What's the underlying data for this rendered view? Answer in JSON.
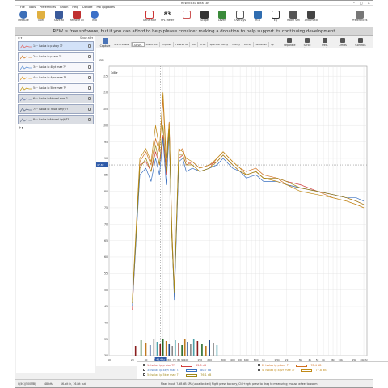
{
  "window": {
    "title": "REW V5.40 Beta 189"
  },
  "menu": [
    "File",
    "Tools",
    "Preferences",
    "Graph",
    "Help",
    "Donate",
    "Pro upgrades"
  ],
  "toolbar": {
    "left": [
      "Measure",
      "Open",
      "Save all",
      "Remove all",
      "Info"
    ],
    "right": [
      "Preferences"
    ],
    "center": [
      "Generator",
      "Scope",
      "Levels",
      "Overlays",
      "RTA",
      "EQ",
      "Room sim",
      "Arithmetic"
    ],
    "spl_meter": {
      "value": "83",
      "label": "SPL meter"
    }
  },
  "donate_text": "REW is free software, but if you can afford to help please consider making a donation to help support its continuing development",
  "left_panel": {
    "header_left": "⊗ ▾",
    "header_right": "Show all ▾",
    "footer": "⟳ ▾"
  },
  "measurements": [
    {
      "name": "1: ·· Isolax ip p stoly ??",
      "color": "#e07070",
      "state": "sel"
    },
    {
      "name": "2: ·· Isolax ip p tanr ??",
      "color": "#d08030",
      "state": "normal"
    },
    {
      "name": "3: ·· Isolax ip 4kyt mae ??",
      "color": "#6a9ad8",
      "state": "normal"
    },
    {
      "name": "4: ·· Isolax ip 4gvr mae ??",
      "color": "#e0a030",
      "state": "normal"
    },
    {
      "name": "5: ·· Isolax ip 5kre mae ??",
      "color": "#c8a020",
      "state": "normal"
    },
    {
      "name": "6: ·· Isolax ip4d seal mae ?",
      "color": "#7080a8",
      "state": "dim"
    },
    {
      "name": "7: ·· Isolax ip ?dual 4sr(r)??",
      "color": "#6a7890",
      "state": "dim"
    },
    {
      "name": "8: ·· Isolax ip4d seal 4p(t)??",
      "color": "#7a8498",
      "state": "dim"
    }
  ],
  "capture_label": "Capture",
  "graph_tabs": [
    "SPL & Phase",
    "All SPL",
    "Distortion",
    "Impulse",
    "Filtered IR",
    "GD",
    "RT60",
    "Spectral Decay",
    "Clarity",
    "Decay",
    "Waterfall",
    "Sp"
  ],
  "graph_tools": [
    "Separate",
    "Scroll bars",
    "Freq. Axis",
    "Limits",
    "Controls"
  ],
  "axis": {
    "ylabel": "SPL",
    "yunit_select": "?dB",
    "marker_left": "47.82",
    "xticks": [
      "10",
      "20",
      "30",
      "40",
      "50",
      "60",
      "70",
      "80",
      "90",
      "100",
      "150",
      "200",
      "300",
      "400",
      "500",
      "600",
      "800",
      "1k",
      "1.5k",
      "2k",
      "3k",
      "4k",
      "5k",
      "6k",
      "8k",
      "10k",
      "15k",
      "20kHz"
    ],
    "xcursor": "46.4Hz",
    "yticks": [
      "115",
      "110",
      "105",
      "100",
      "95",
      "90",
      "85",
      "80",
      "75",
      "70",
      "65",
      "60",
      "55",
      "50",
      "45",
      "40",
      "35",
      "30"
    ]
  },
  "legend": [
    {
      "name": "1: Isolax ip p stor ??",
      "value": "63.8 dB",
      "color": "#d04040"
    },
    {
      "name": "2: Isolax ip p tanr ??",
      "value": "78.4 dB",
      "color": "#d07020"
    },
    {
      "name": "3: Isolax ip 4kyt mae ??",
      "value": "80.7 dB",
      "color": "#3a70c0"
    },
    {
      "name": "4: Isolax ip 4gvr mae ??",
      "value": "77.8 dB",
      "color": "#c08a18"
    },
    {
      "name": "5: Isolax ip 5kre mae ??",
      "value": "76.1 dB",
      "color": "#a08818"
    }
  ],
  "status": {
    "left": "C(IIC)(500MB)",
    "rate": "48 kHz",
    "bits": "16-bit in, 16-bit out",
    "hint": "Mass input: ?-dB dB SPL (uncalibrated)  Right press to carry, Ctrl+right press to drag to measuring; mouse wheel to zoom"
  },
  "chart_data": {
    "type": "line",
    "xlabel": "",
    "ylabel": "SPL",
    "x_scale": "log",
    "xlim": [
      10,
      22000
    ],
    "ylim": [
      30,
      118
    ],
    "grid": true,
    "x": [
      20,
      25,
      30,
      35,
      40,
      45,
      50,
      55,
      60,
      65,
      70,
      80,
      90,
      100,
      120,
      150,
      200,
      250,
      300,
      400,
      500,
      600,
      800,
      1000,
      1500,
      2000,
      3000,
      5000,
      8000,
      12000,
      16000,
      20000
    ],
    "series": [
      {
        "name": "1: Isolax ip p stor ??",
        "color": "#d04040",
        "values": [
          44,
          88,
          89,
          86,
          92,
          88,
          97,
          85,
          101,
          68,
          49,
          90,
          91,
          88,
          89,
          87,
          88,
          89,
          91,
          88,
          86,
          85,
          86,
          84,
          84,
          83,
          82,
          80,
          79,
          78,
          77,
          76
        ]
      },
      {
        "name": "2: Isolax ip p tanr ??",
        "color": "#d07020",
        "values": [
          46,
          89,
          92,
          88,
          96,
          92,
          108,
          88,
          100,
          66,
          48,
          92,
          93,
          89,
          88,
          86,
          87,
          90,
          92,
          89,
          87,
          86,
          87,
          85,
          84,
          82,
          81,
          80,
          78,
          77,
          76,
          75
        ]
      },
      {
        "name": "3: Isolax ip 4kyt mae ??",
        "color": "#3a70c0",
        "values": [
          45,
          85,
          87,
          83,
          90,
          85,
          96,
          82,
          98,
          67,
          47,
          89,
          90,
          86,
          87,
          86,
          87,
          88,
          90,
          87,
          86,
          84,
          85,
          83,
          83,
          82,
          81,
          80,
          79,
          78,
          78,
          77
        ]
      },
      {
        "name": "4: Isolax ip 4gvr mae ??",
        "color": "#c08a18",
        "values": [
          47,
          90,
          93,
          89,
          100,
          93,
          110,
          90,
          101,
          69,
          50,
          93,
          92,
          90,
          89,
          87,
          88,
          90,
          92,
          89,
          87,
          85,
          86,
          84,
          83,
          82,
          80,
          79,
          78,
          77,
          76,
          75
        ]
      },
      {
        "name": "5: Isolax ip 5kre mae ??",
        "color": "#a08818",
        "values": [
          46,
          87,
          90,
          86,
          94,
          88,
          100,
          86,
          99,
          66,
          49,
          91,
          91,
          88,
          88,
          86,
          87,
          89,
          91,
          88,
          86,
          85,
          86,
          84,
          84,
          83,
          81,
          80,
          79,
          78,
          77,
          76
        ]
      }
    ],
    "bars": {
      "color_set": [
        "#8a1e1e",
        "#2a6a2a",
        "#c07a20",
        "#224a8a",
        "#888888",
        "#4aa0a8"
      ],
      "x": [
        22,
        26,
        30,
        34,
        38,
        42,
        46,
        50,
        55,
        60,
        66,
        72,
        80,
        88,
        96,
        104,
        114,
        125,
        140,
        160,
        180,
        200,
        225,
        250
      ]
    }
  }
}
